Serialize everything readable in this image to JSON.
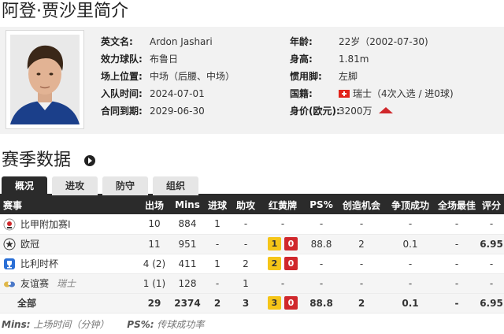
{
  "page_title": "阿登·贾沙里简介",
  "profile": {
    "left": [
      {
        "label": "英文名:",
        "value": "Ardon Jashari"
      },
      {
        "label": "效力球队:",
        "value": "布鲁日"
      },
      {
        "label": "场上位置:",
        "value": "中场（后腰、中场）"
      },
      {
        "label": "入队时间:",
        "value": "2024-07-01"
      },
      {
        "label": "合同到期:",
        "value": "2029-06-30"
      }
    ],
    "right": [
      {
        "label": "年龄:",
        "value": "22岁（2002-07-30)"
      },
      {
        "label": "身高:",
        "value": "1.81m"
      },
      {
        "label": "惯用脚:",
        "value": "左脚"
      },
      {
        "label": "国籍:",
        "value": "瑞士（4次入选 / 进0球)"
      },
      {
        "label": "身价(欧元):",
        "value": "3200万"
      }
    ],
    "nationality_flag": "switzerland-flag",
    "value_trend": "up",
    "colors": {
      "trend_up": "#d0282c",
      "flag": "#e2231a"
    }
  },
  "section_title": "赛季数据",
  "tabs": [
    "概况",
    "进攻",
    "防守",
    "组织"
  ],
  "active_tab": "概况",
  "table": {
    "headers": [
      "赛事",
      "出场",
      "Mins",
      "进球",
      "助攻",
      "红黄牌",
      "PS%",
      "创造机会",
      "争顶成功",
      "全场最佳",
      "评分"
    ],
    "rows": [
      {
        "comp": "比甲附加赛I",
        "sub": "",
        "apps": "10",
        "mins": "884",
        "goals": "1",
        "assists": "-",
        "yellow": "",
        "red": "",
        "cards_text": "-",
        "ps": "-",
        "chances": "-",
        "aerials": "-",
        "motm": "-",
        "rating": "-",
        "icon": "belgian-league-icon"
      },
      {
        "comp": "欧冠",
        "sub": "",
        "apps": "11",
        "mins": "951",
        "goals": "-",
        "assists": "-",
        "yellow": "1",
        "red": "0",
        "cards_text": "",
        "ps": "88.8",
        "chances": "2",
        "aerials": "0.1",
        "motm": "-",
        "rating": "6.95",
        "icon": "champions-league-icon"
      },
      {
        "comp": "比利时杯",
        "sub": "",
        "apps": "4 (2)",
        "mins": "411",
        "goals": "1",
        "assists": "2",
        "yellow": "2",
        "red": "0",
        "cards_text": "",
        "ps": "-",
        "chances": "-",
        "aerials": "-",
        "motm": "-",
        "rating": "-",
        "icon": "belgian-cup-icon"
      },
      {
        "comp": "友谊赛",
        "sub": "瑞士",
        "apps": "1 (1)",
        "mins": "128",
        "goals": "-",
        "assists": "1",
        "yellow": "",
        "red": "",
        "cards_text": "-",
        "ps": "-",
        "chances": "-",
        "aerials": "-",
        "motm": "-",
        "rating": "-",
        "icon": "friendly-icon"
      }
    ],
    "total": {
      "comp": "全部",
      "apps": "29",
      "mins": "2374",
      "goals": "2",
      "assists": "3",
      "yellow": "3",
      "red": "0",
      "ps": "88.8",
      "chances": "2",
      "aerials": "0.1",
      "motm": "-",
      "rating": "6.95"
    }
  },
  "footnote": {
    "mins_key": "Mins:",
    "mins_desc": "上场时间（分钟）",
    "ps_key": "PS%:",
    "ps_desc": "传球成功率"
  }
}
